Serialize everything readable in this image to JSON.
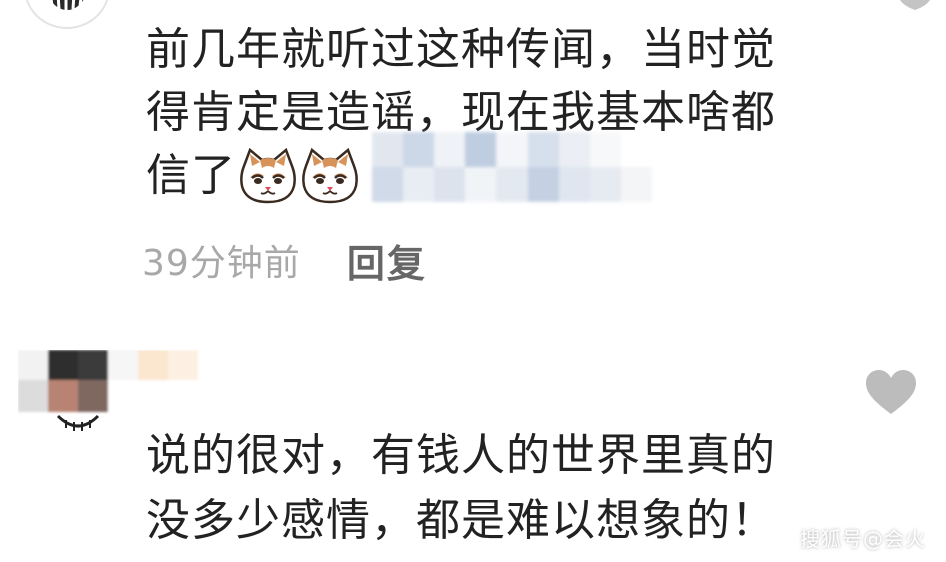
{
  "comments": [
    {
      "lines": [
        "前几年就听过这种传闻，当时觉",
        "得肯定是造谣，现在我基本啥都",
        "信了"
      ],
      "emojis": [
        "cat-face-emoji",
        "cat-face-emoji"
      ],
      "time": "39分钟前",
      "reply_label": "回复"
    },
    {
      "lines": [
        "说的很对，有钱人的世界里真的",
        "没多少感情，都是难以想象的！"
      ]
    }
  ],
  "watermark": "搜狐号@会火",
  "icons": {
    "like": "heart-icon"
  },
  "colors": {
    "text": "#222222",
    "time": "#a8a8a8",
    "reply": "#666666",
    "heart": "#bcbcbc"
  }
}
